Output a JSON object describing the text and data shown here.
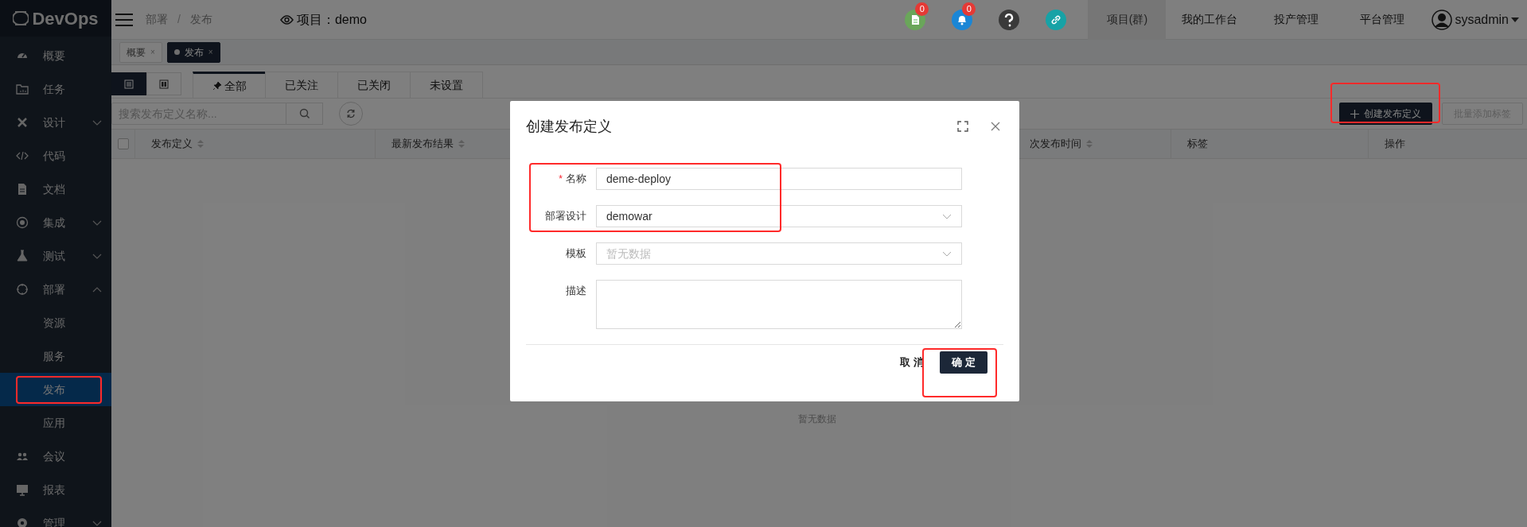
{
  "sidebar": {
    "logo": "DevOps",
    "items": [
      {
        "label": "概要",
        "kind": "link",
        "selected": false
      },
      {
        "label": "任务",
        "kind": "link",
        "selected": false
      },
      {
        "label": "设计",
        "kind": "group",
        "expanded": false,
        "selected": false
      },
      {
        "label": "代码",
        "kind": "link",
        "selected": false
      },
      {
        "label": "文档",
        "kind": "link",
        "selected": false
      },
      {
        "label": "集成",
        "kind": "group",
        "expanded": false,
        "selected": false
      },
      {
        "label": "测试",
        "kind": "group",
        "expanded": false,
        "selected": false
      },
      {
        "label": "部署",
        "kind": "group",
        "expanded": true,
        "selected": false,
        "children": [
          {
            "label": "资源",
            "selected": false
          },
          {
            "label": "服务",
            "selected": false
          },
          {
            "label": "发布",
            "selected": true
          },
          {
            "label": "应用",
            "selected": false
          }
        ]
      },
      {
        "label": "会议",
        "kind": "link",
        "selected": false
      },
      {
        "label": "报表",
        "kind": "link",
        "selected": false
      },
      {
        "label": "管理",
        "kind": "group",
        "expanded": false,
        "selected": false
      }
    ]
  },
  "header": {
    "breadcrumb": [
      "部署",
      "发布"
    ],
    "separator": "/",
    "project": "项目：demo",
    "icons": [
      {
        "badge": "0",
        "color": "#6aa65a"
      },
      {
        "badge": "0",
        "color": "#1a86d6"
      },
      {
        "color": "#3a3a3a"
      },
      {
        "color": "#17a2a6"
      }
    ],
    "nav": [
      {
        "label": "项目(群)",
        "selected": true
      },
      {
        "label": "我的工作台",
        "selected": false
      },
      {
        "label": "投产管理",
        "selected": false
      },
      {
        "label": "平台管理",
        "selected": false
      }
    ],
    "user": "sysadmin"
  },
  "page_tabs": [
    {
      "label": "概要",
      "selected": false,
      "close": "×"
    },
    {
      "label": "发布",
      "selected": true,
      "close": "×"
    }
  ],
  "view_toggle": [
    {
      "selected": true
    },
    {
      "selected": false
    }
  ],
  "filter_tabs": [
    {
      "label": "全部",
      "selected": true
    },
    {
      "label": "已关注",
      "selected": false
    },
    {
      "label": "已关闭",
      "selected": false
    },
    {
      "label": "未设置",
      "selected": false
    }
  ],
  "search": {
    "placeholder": "搜索发布定义名称..."
  },
  "actions": [
    {
      "label": "创建发布定义",
      "disabled": false
    },
    {
      "label": "批量添加标签",
      "disabled": true
    }
  ],
  "table": {
    "select_all": {
      "checked": false
    },
    "columns": [
      "发布定义",
      "最新发布结果",
      "次发布时间",
      "标签",
      "操作"
    ],
    "empty": "暂无数据"
  },
  "dialog": {
    "title": "创建发布定义",
    "required_mark": "*",
    "fields": [
      {
        "label": "名称",
        "required": true,
        "kind": "input",
        "value": "deme-deploy"
      },
      {
        "label": "部署设计",
        "required": false,
        "kind": "select",
        "value": "demowar"
      },
      {
        "label": "模板",
        "required": false,
        "kind": "select",
        "placeholder": "暂无数据"
      },
      {
        "label": "描述",
        "required": false,
        "kind": "textarea"
      }
    ],
    "cancel": "取 消",
    "ok": "确 定"
  }
}
